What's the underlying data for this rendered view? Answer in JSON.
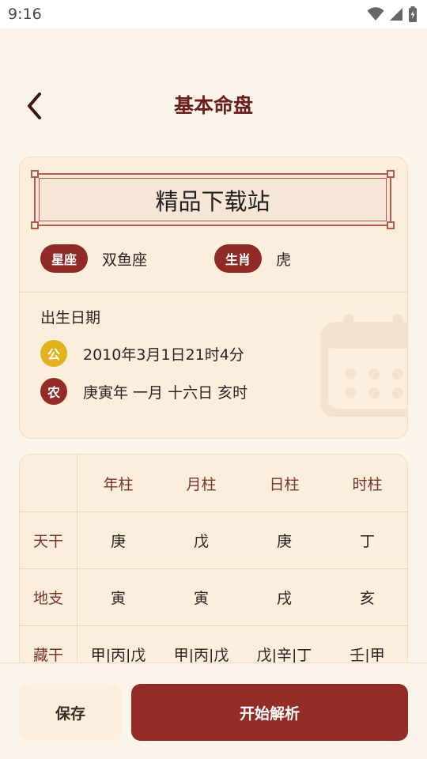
{
  "status_bar": {
    "time": "9:16",
    "icons": [
      "wifi-icon",
      "signal-icon",
      "battery-icon"
    ]
  },
  "header": {
    "title": "基本命盘",
    "back_icon": "chevron-left-icon"
  },
  "profile": {
    "name": "精品下载站",
    "zodiac_label": "星座",
    "zodiac_value": "双鱼座",
    "shengxiao_label": "生肖",
    "shengxiao_value": "虎",
    "birth_label": "出生日期",
    "solar_badge": "公",
    "solar_date": "2010年3月1日21时4分",
    "lunar_badge": "农",
    "lunar_date": "庚寅年 一月 十六日 亥时",
    "watermark_icon": "calendar-icon"
  },
  "pillars": {
    "columns": [
      "年柱",
      "月柱",
      "日柱",
      "时柱"
    ],
    "rows": [
      {
        "label": "天干",
        "values": [
          "庚",
          "戊",
          "庚",
          "丁"
        ]
      },
      {
        "label": "地支",
        "values": [
          "寅",
          "寅",
          "戌",
          "亥"
        ]
      },
      {
        "label": "藏干",
        "values": [
          "甲|丙|戊",
          "甲|丙|戊",
          "戊|辛|丁",
          "壬|甲"
        ]
      }
    ]
  },
  "footer": {
    "save_label": "保存",
    "analyze_label": "开始解析"
  },
  "colors": {
    "accent": "#932b27",
    "title": "#6b1e1c",
    "solar_badge": "#e4b21f",
    "card_bg": "#fbeedd",
    "page_bg": "#faf4ea"
  }
}
